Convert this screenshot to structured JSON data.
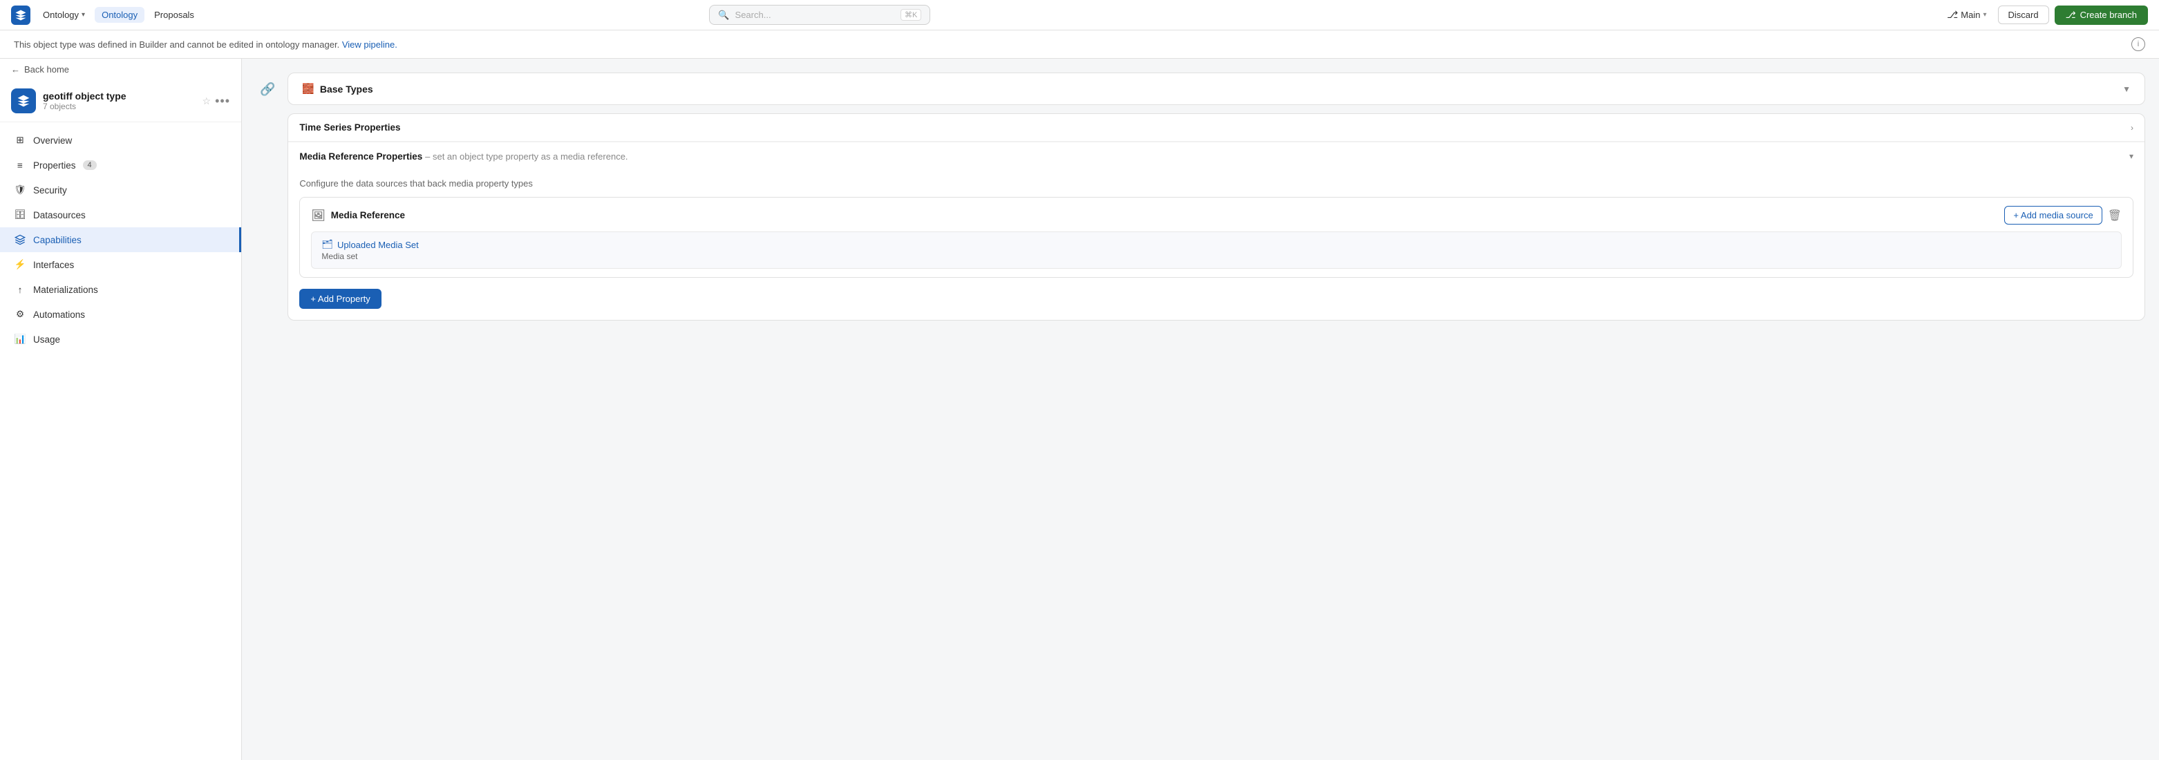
{
  "topnav": {
    "logo_label": "Ontology App",
    "nav_items": [
      {
        "label": "Ontology",
        "has_dropdown": true,
        "active": false
      },
      {
        "label": "Ontology",
        "has_dropdown": false,
        "active": true
      },
      {
        "label": "Proposals",
        "has_dropdown": false,
        "active": false
      }
    ],
    "search_placeholder": "Search...",
    "search_shortcut": "⌘K",
    "branch_label": "Main",
    "discard_label": "Discard",
    "create_branch_label": "Create branch"
  },
  "info_banner": {
    "text": "This object type was defined in Builder and cannot be edited in ontology manager.",
    "link_text": "View pipeline.",
    "info_icon": "ℹ"
  },
  "sidebar": {
    "back_home_label": "Back home",
    "object": {
      "name": "geotiff object type",
      "sub": "7 objects"
    },
    "nav_items": [
      {
        "label": "Overview",
        "icon": "grid",
        "active": false,
        "badge": null
      },
      {
        "label": "Properties",
        "icon": "list",
        "active": false,
        "badge": "4"
      },
      {
        "label": "Security",
        "icon": "shield",
        "active": false,
        "badge": null
      },
      {
        "label": "Datasources",
        "icon": "database",
        "active": false,
        "badge": null
      },
      {
        "label": "Capabilities",
        "icon": "layers",
        "active": true,
        "badge": null
      },
      {
        "label": "Interfaces",
        "icon": "plug",
        "active": false,
        "badge": null
      },
      {
        "label": "Materializations",
        "icon": "upload",
        "active": false,
        "badge": null
      },
      {
        "label": "Automations",
        "icon": "settings",
        "active": false,
        "badge": null
      },
      {
        "label": "Usage",
        "icon": "bar-chart",
        "active": false,
        "badge": null
      }
    ]
  },
  "main": {
    "base_types": {
      "title": "Base Types",
      "chevron": "▼"
    },
    "time_series": {
      "title": "Time Series Properties",
      "chevron": "›"
    },
    "media_reference": {
      "panel_title": "Media Reference Properties",
      "panel_desc": "– set an object type property as a media reference.",
      "config_text": "Configure the data sources that back media property types",
      "card_title": "Media Reference",
      "add_media_label": "+ Add media source",
      "delete_icon": "🗑",
      "source_name": "Uploaded Media Set",
      "source_sub": "Media set",
      "add_property_label": "+ Add Property"
    }
  }
}
